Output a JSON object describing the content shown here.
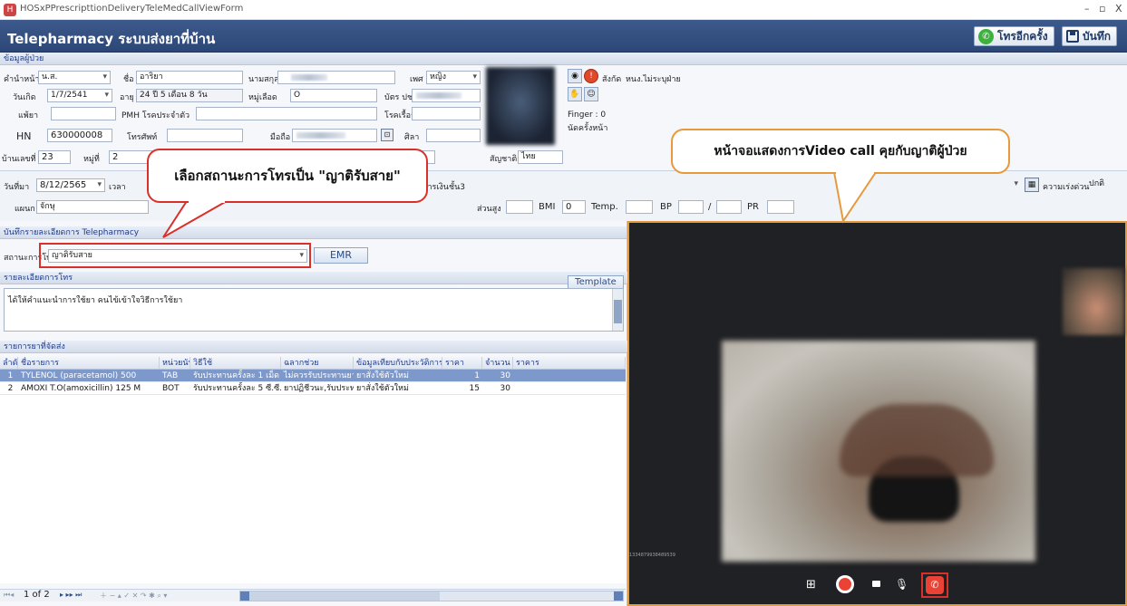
{
  "window": {
    "title": "HOSxPPrescripttionDeliveryTeleMedCallViewForm",
    "min": "–",
    "max": "▫",
    "close": "X"
  },
  "header": {
    "title": "Telepharmacy ระบบส่งยาที่บ้าน",
    "call_again": "โทรอีกครั้ง",
    "save": "บันทึก"
  },
  "patient": {
    "section": "ข้อมูลผู้ป่วย",
    "prefix_label": "คำนำหน้า",
    "prefix": "น.ส.",
    "name_label": "ชื่อ",
    "name": "อาริยา",
    "surname_label": "นามสกุล",
    "sex_label": "เพศ",
    "sex": "หญิง",
    "dob_label": "วันเกิด",
    "dob": "1/7/2541",
    "age_label": "อายุ",
    "age": "24 ปี 5 เดือน 8 วัน",
    "blood_label": "หมู่เลือด",
    "blood": "O",
    "cid_label": "บัตร ปชช.",
    "allergy_label": "แพ้ยา",
    "pmh_label": "PMH โรคประจำตัว",
    "chronic_label": "โรคเรื้อรัง",
    "hn_label": "HN",
    "hn": "630000008",
    "phone_label": "โทรศัพท์",
    "mobile_label": "มือถือ",
    "religion_label": "ศิลา",
    "house_label": "บ้านเลขที่",
    "house": "23",
    "moo_label": "หมู่ที่",
    "moo": "2",
    "nation_label": "สัญชาติ",
    "nation": "ไทย",
    "affil_label": "สังกัด",
    "affil": "หนง.ไม่ระบุฝ่าย",
    "finger": "Finger : 0",
    "appoint": "นัดครั้งหน้า"
  },
  "visit": {
    "date_label": "วันที่มา",
    "date": "8/12/2565",
    "time_label": "เวลา",
    "dept_label": "แผนก",
    "dept": "จักษุ",
    "right_value": "การเงินชั้น3",
    "urgency_label": "ความเร่งด่วน",
    "urgency": "ปกติ",
    "height_label": "ส่วนสูง",
    "bmi_label": "BMI",
    "bmi": "0",
    "temp_label": "Temp.",
    "bp_label": "BP",
    "bp_sep": "/",
    "pr_label": "PR"
  },
  "telepharmacy": {
    "section": "บันทึกรายละเอียดการ Telepharmacy",
    "status_label": "สถานะการโทร",
    "status": "ญาติรับสาย",
    "emr": "EMR",
    "detail_label": "รายละเอียดการโทร",
    "template": "Template",
    "detail_text": "ได้ให้คำแนะนำการใช้ยา คนไข้เข้าใจวิธีการใช้ยา"
  },
  "drugs": {
    "section": "รายการยาที่จัดส่ง",
    "columns": [
      "ลำดับ",
      "ชื่อรายการ",
      "หน่วยนับ",
      "วิธีใช้",
      "ฉลากช่วย",
      "ข้อมูลเทียบกับประวัติการสั่ง",
      "ราคา",
      "จำนวน",
      "ราคาร"
    ],
    "rows": [
      [
        "1",
        "TYLENOL (paracetamol) 500",
        "TAB",
        "รับประทานครั้งละ 1 เม็ด ทุก 4-",
        "ไม่ควรรับประทานยา",
        "ยาสั่งใช้ตัวใหม่",
        "1",
        "30",
        ""
      ],
      [
        "2",
        "AMOXI T.O(amoxicillin) 125 M",
        "BOT",
        "รับประทานครั้งละ 5 ซี.ซี. วันละ",
        "ยาปฏิชีวนะ,รับประทา",
        "ยาสั่งใช้ตัวใหม่",
        "15",
        "30",
        ""
      ]
    ],
    "pager": "1 of 2"
  },
  "callouts": {
    "status": "เลือกสถานะการโทรเป็น \"ญาติรับสาย\"",
    "video": "หน้าจอแสดงการVideo call คุยกับญาติผู้ป่วย"
  },
  "video": {
    "stamp": "1334879938489539"
  },
  "colors": {
    "header": "#2c4777",
    "highlight": "#d9302a",
    "video_border": "#e69a3c",
    "selected_row": "#7d99cc"
  }
}
